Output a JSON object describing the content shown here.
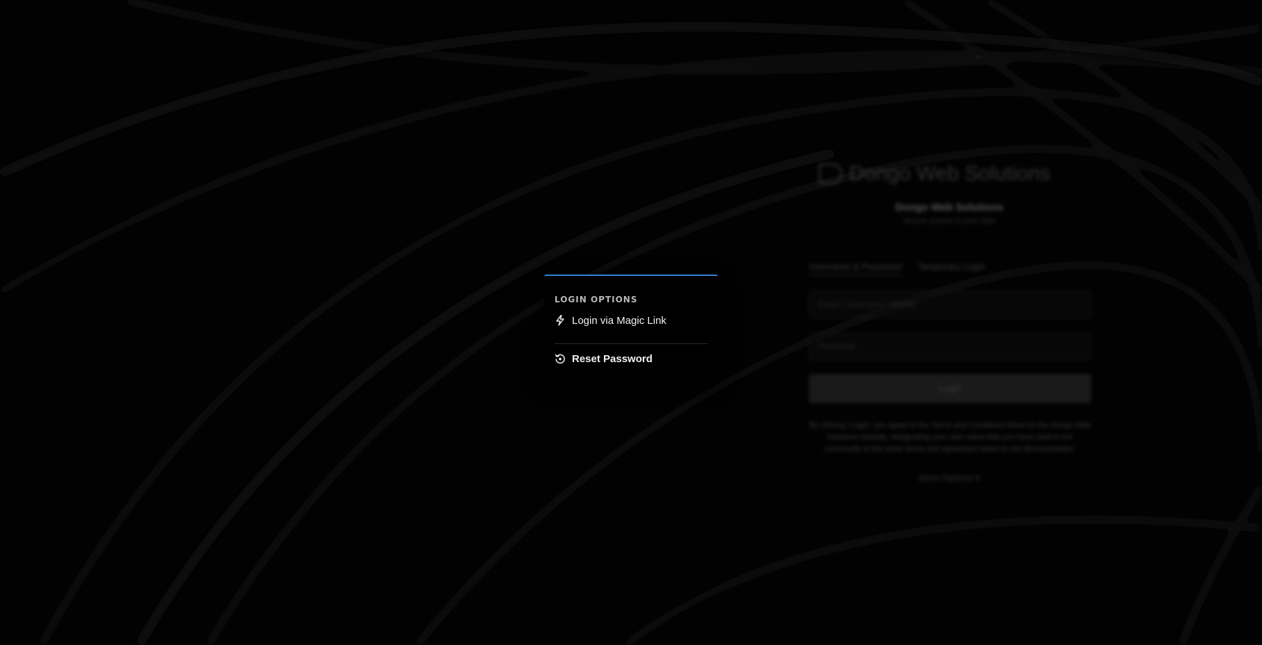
{
  "background": {
    "brand_name": "Dongo Web Solutions",
    "title": "Dongo Web Solutions",
    "subtitle": "Secure access to your data",
    "tabs": [
      {
        "label": "Username & Password",
        "active": true
      },
      {
        "label": "Temporary Login",
        "active": false
      }
    ],
    "username_placeholder": "Email / Username / Mobile",
    "password_placeholder": "Password",
    "login_label": "Login",
    "terms_text": "By clicking \"Login\" you agree to the Terms and Conditions listed on the Dongo Web Solutions website, designating your user name that you have used in our community to the same terms and agreement listed on the documentation.",
    "more_options_label": "More Options ▾"
  },
  "login_options": {
    "header": "LOGIN OPTIONS",
    "items": [
      {
        "label": "Login via Magic Link",
        "icon": "lightning-icon"
      },
      {
        "label": "Reset Password",
        "icon": "reset-icon"
      }
    ]
  },
  "colors": {
    "accent": "#3b82d6",
    "background": "#020202",
    "popup_background": "#000000",
    "text": "#f2f2f2"
  }
}
